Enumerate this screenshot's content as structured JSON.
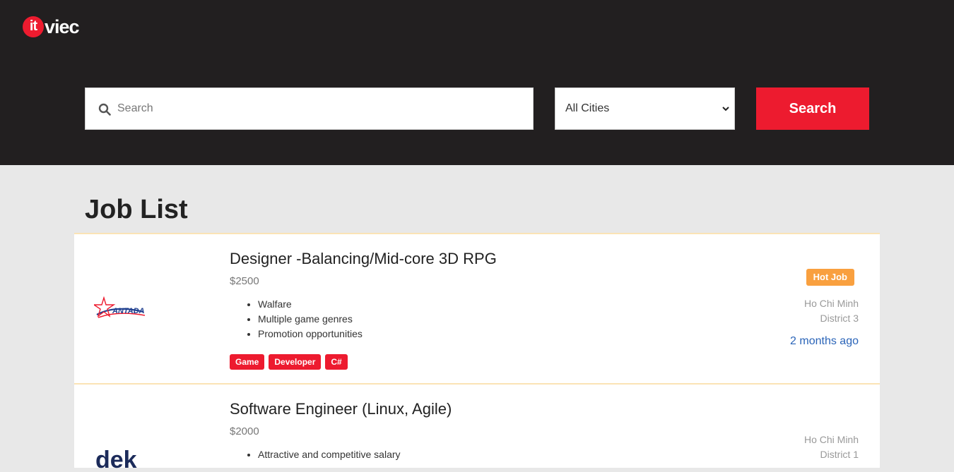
{
  "brand": {
    "logo_it": "it",
    "logo_viec": "viec"
  },
  "search": {
    "placeholder": "Search",
    "value": "",
    "city_selected": "All Cities",
    "button_label": "Search"
  },
  "colors": {
    "header_bg": "#221f20",
    "accent": "#ed1b2f",
    "hot": "#f9a03f",
    "link": "#2a64b8"
  },
  "page": {
    "title": "Job List"
  },
  "jobs": [
    {
      "company_logo_text": "ANTADA",
      "title": "Designer -Balancing/Mid-core 3D RPG",
      "salary": "$2500",
      "benefits": [
        "Walfare",
        "Multiple game genres",
        "Promotion opportunities"
      ],
      "tags": [
        "Game",
        "Developer",
        "C#"
      ],
      "badge": "Hot Job",
      "city": "Ho Chi Minh",
      "district": "District 3",
      "posted": "2 months ago"
    },
    {
      "company_logo_text": "dek",
      "title": "Software Engineer (Linux, Agile)",
      "salary": "$2000",
      "benefits": [
        "Attractive and competitive salary"
      ],
      "city": "Ho Chi Minh",
      "district": "District 1"
    }
  ]
}
